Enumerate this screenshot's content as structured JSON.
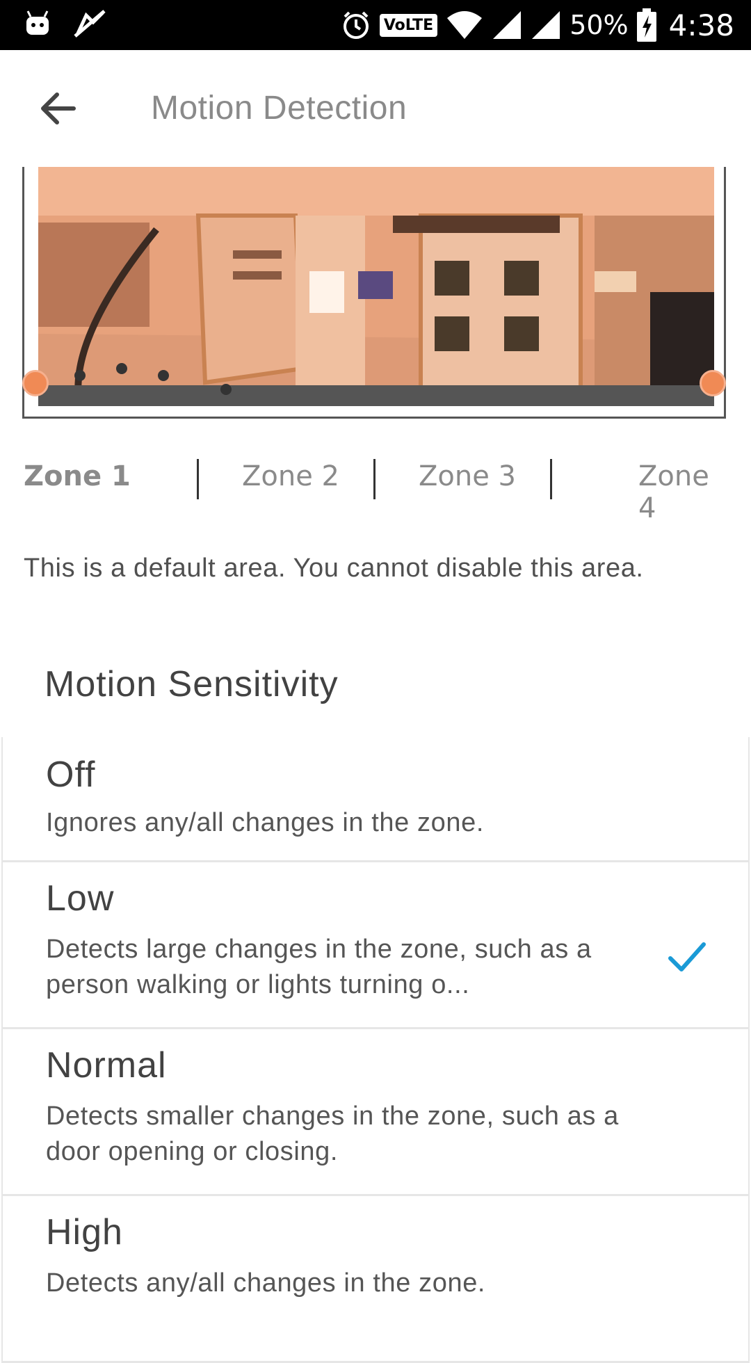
{
  "status_bar": {
    "battery_percent": "50%",
    "time": "4:38",
    "volte": "VoLTE",
    "icons": [
      "android-icon",
      "notification-off-icon",
      "alarm-icon",
      "volte-icon",
      "wifi-icon",
      "signal-icon",
      "signal-icon",
      "battery-charging-icon"
    ]
  },
  "app_bar": {
    "title": "Motion Detection",
    "back_icon": "arrow-back-icon"
  },
  "zones": {
    "tabs": [
      {
        "label": "Zone 1",
        "active": true
      },
      {
        "label": "Zone 2",
        "active": false
      },
      {
        "label": "Zone 3",
        "active": false
      },
      {
        "label": "Zone 4",
        "active": false
      }
    ]
  },
  "info_text": "This is a default area. You cannot disable this area.",
  "sensitivity": {
    "title": "Motion Sensitivity",
    "options": [
      {
        "label": "Off",
        "description": "Ignores any/all changes in the zone.",
        "selected": false
      },
      {
        "label": "Low",
        "description": "Detects large changes in the zone, such as a person walking or lights turning o...",
        "selected": true
      },
      {
        "label": "Normal",
        "description": "Detects smaller changes in the zone, such as a door opening or closing.",
        "selected": false
      },
      {
        "label": "High",
        "description": "Detects any/all changes in the zone.",
        "selected": false
      }
    ]
  },
  "colors": {
    "accent": "#1a9ad6",
    "zone_overlay": "#f08a55",
    "status_bar_bg": "#000000"
  }
}
